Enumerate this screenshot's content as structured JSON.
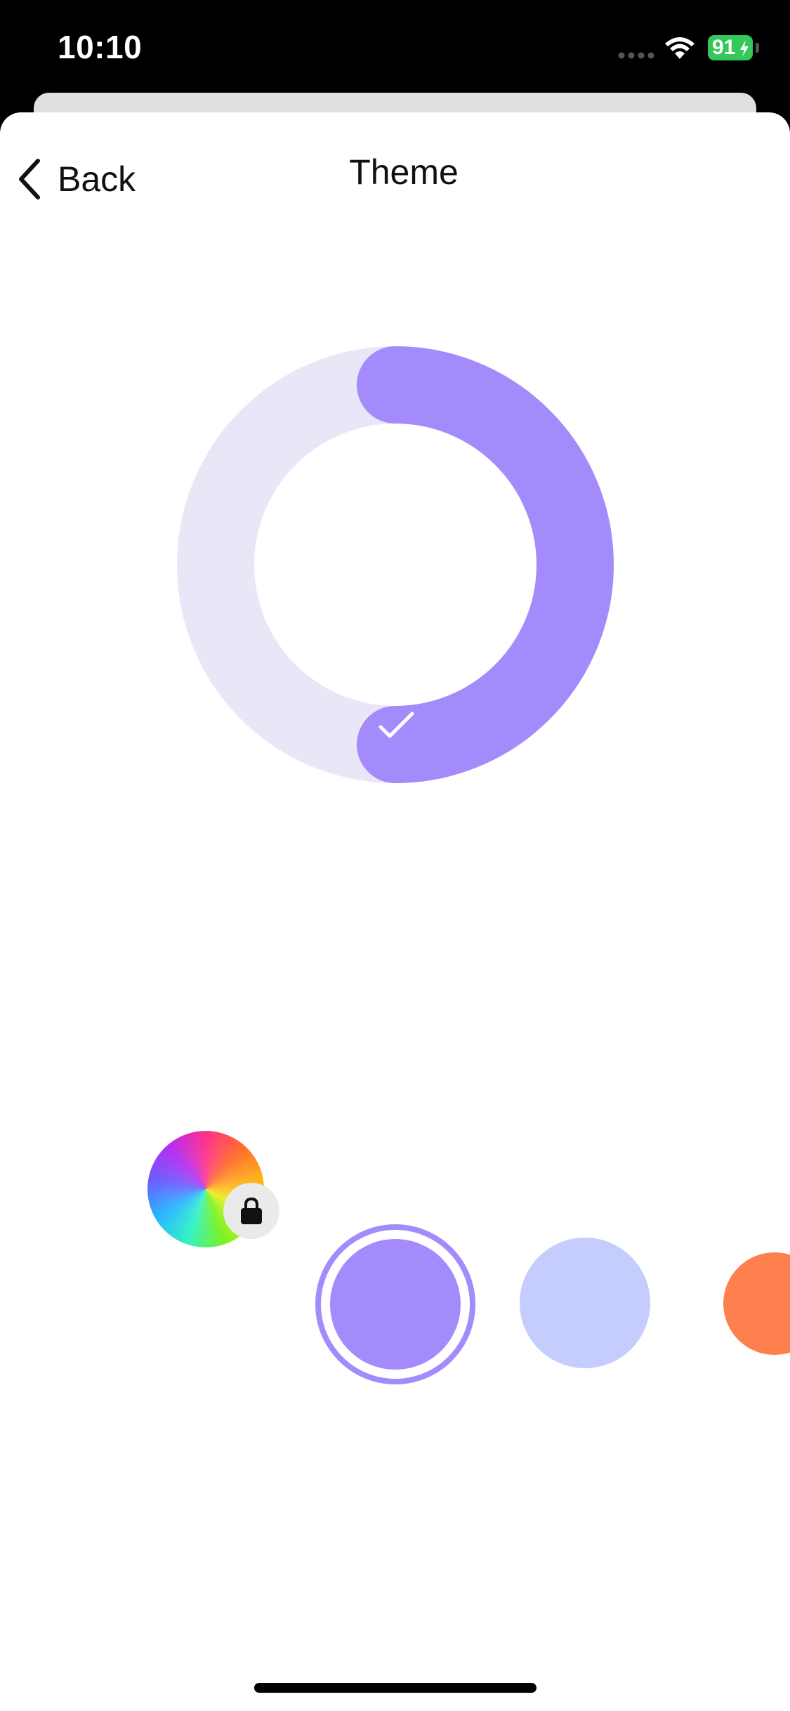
{
  "status_bar": {
    "time": "10:10",
    "battery": "91",
    "signal_icon": "cellular-signal-icon",
    "wifi_icon": "wifi-icon"
  },
  "nav": {
    "back_label": "Back",
    "title": "Theme",
    "back_icon": "chevron-left-icon"
  },
  "preview": {
    "accent_color": "#a38bfc",
    "track_color": "#e8e6f7",
    "icon": "checkmark-icon"
  },
  "swatches": [
    {
      "name": "rainbow",
      "color": "multicolor",
      "locked": true,
      "icon": "lock-icon"
    },
    {
      "name": "purple",
      "color": "#a38bfc",
      "selected": true
    },
    {
      "name": "periwinkle",
      "color": "#c4cdfd"
    },
    {
      "name": "orange",
      "color": "#ff804f"
    }
  ]
}
